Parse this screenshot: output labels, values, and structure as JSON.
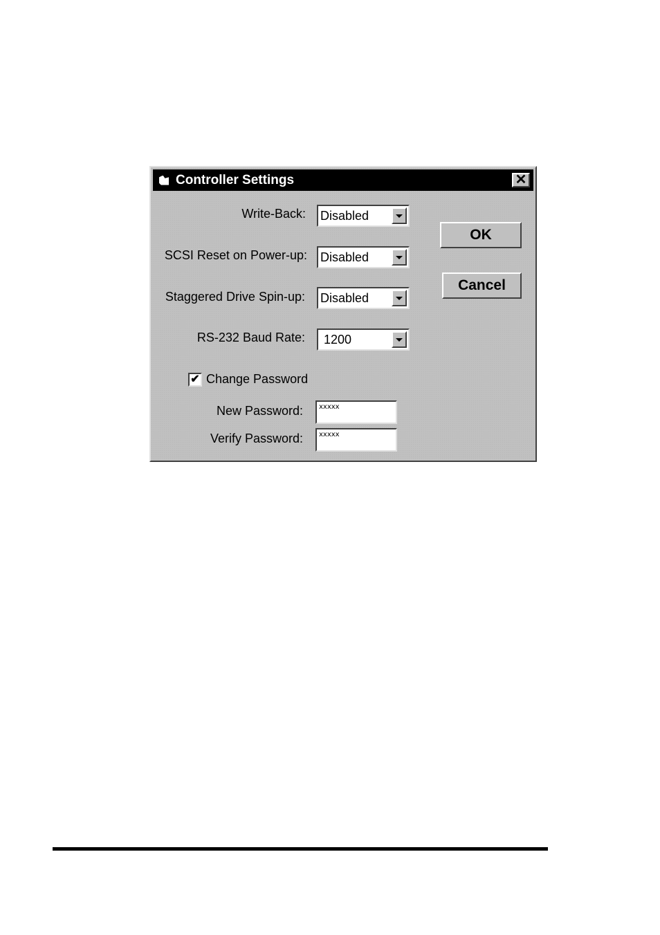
{
  "dialog": {
    "title": "Controller Settings",
    "title_icon": "controller-app-icon",
    "close_label": "✕",
    "fields": [
      {
        "label": "Write-Back:",
        "value": "Disabled"
      },
      {
        "label": "SCSI Reset on Power-up:",
        "value": "Disabled"
      },
      {
        "label": "Staggered Drive Spin-up:",
        "value": "Disabled"
      },
      {
        "label": "RS-232 Baud Rate:",
        "value": "1200"
      }
    ],
    "change_password": {
      "label": "Change Password",
      "checked": true,
      "check_glyph": "✔"
    },
    "new_password": {
      "label": "New Password:",
      "value": "xxxxx"
    },
    "verify_password": {
      "label": "Verify Password:",
      "value": "xxxxx"
    },
    "buttons": {
      "ok": "OK",
      "cancel": "Cancel"
    }
  }
}
